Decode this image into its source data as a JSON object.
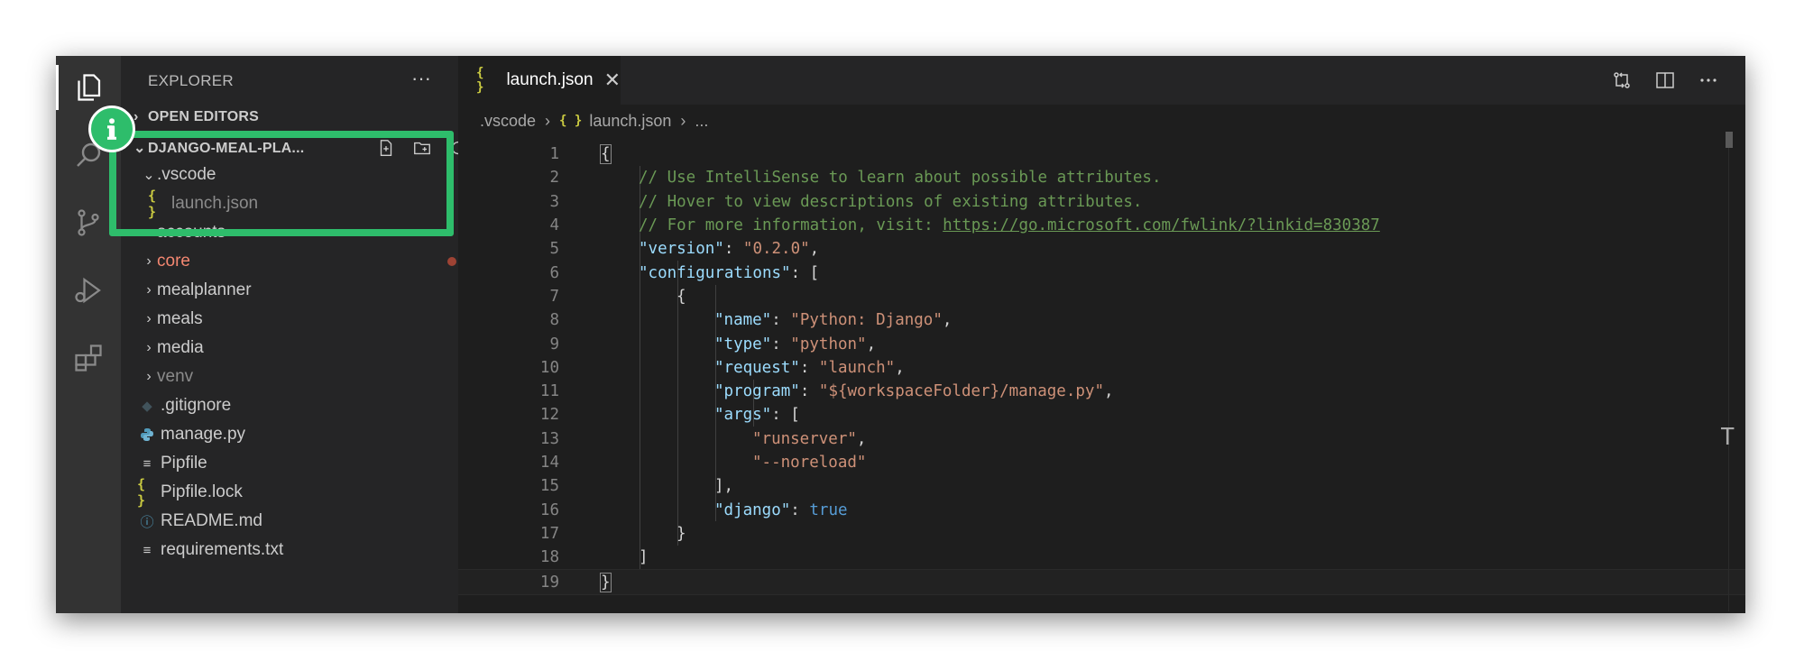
{
  "sidebar": {
    "title": "EXPLORER",
    "more": "···",
    "open_editors": "OPEN EDITORS",
    "project": "DJANGO-MEAL-PLA...",
    "items": [
      {
        "label": ".vscode",
        "type": "folder",
        "expanded": true
      },
      {
        "label": "launch.json",
        "type": "json"
      },
      {
        "label": "accounts",
        "type": "folder"
      },
      {
        "label": "core",
        "type": "folder",
        "status": "modified"
      },
      {
        "label": "mealplanner",
        "type": "folder"
      },
      {
        "label": "meals",
        "type": "folder"
      },
      {
        "label": "media",
        "type": "folder"
      },
      {
        "label": "venv",
        "type": "folder",
        "dim": true
      },
      {
        "label": ".gitignore",
        "type": "git"
      },
      {
        "label": "manage.py",
        "type": "python"
      },
      {
        "label": "Pipfile",
        "type": "text"
      },
      {
        "label": "Pipfile.lock",
        "type": "json"
      },
      {
        "label": "README.md",
        "type": "info"
      },
      {
        "label": "requirements.txt",
        "type": "text"
      }
    ]
  },
  "editor": {
    "tab_label": "launch.json",
    "tab_close": "✕",
    "breadcrumb": [
      ".vscode",
      "launch.json",
      "..."
    ],
    "line_numbers": [
      "1",
      "2",
      "3",
      "4",
      "5",
      "6",
      "7",
      "8",
      "9",
      "10",
      "11",
      "12",
      "13",
      "14",
      "15",
      "16",
      "17",
      "18",
      "19"
    ]
  },
  "code": {
    "l1": "{",
    "l2": "// Use IntelliSense to learn about possible attributes.",
    "l3": "// Hover to view descriptions of existing attributes.",
    "l4_text": "// For more information, visit: ",
    "l4_link": "https://go.microsoft.com/fwlink/?linkid=830387",
    "l5_key": "\"version\"",
    "l5_val": "\"0.2.0\"",
    "l6_key": "\"configurations\"",
    "l6_rest": ": [",
    "l7": "{",
    "l8_key": "\"name\"",
    "l8_val": "\"Python: Django\"",
    "l9_key": "\"type\"",
    "l9_val": "\"python\"",
    "l10_key": "\"request\"",
    "l10_val": "\"launch\"",
    "l11_key": "\"program\"",
    "l11_val": "\"${workspaceFolder}/manage.py\"",
    "l12_key": "\"args\"",
    "l12_rest": ": [",
    "l13_val": "\"runserver\"",
    "l14_val": "\"--noreload\"",
    "l15": "],",
    "l16_key": "\"django\"",
    "l16_val": "true",
    "l17": "}",
    "l18": "]",
    "l19": "}"
  },
  "overlay": {
    "badge_icon": "info-icon",
    "highlight_color": "#2ebd6b"
  }
}
